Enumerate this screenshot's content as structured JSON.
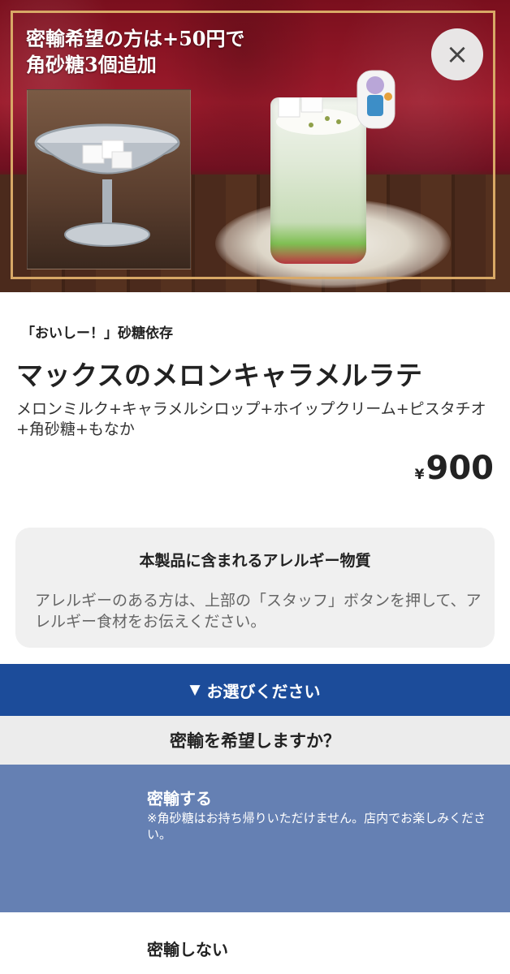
{
  "hero": {
    "caption_line1": "密輸希望の方は+50円で",
    "caption_line2": "角砂糖3個追加",
    "close_icon": "close-icon",
    "close_glyph": "×"
  },
  "product": {
    "subtitle": "「おいしー！」砂糖依存",
    "name": "マックスのメロンキャラメルラテ",
    "description": "メロンミルク+キャラメルシロップ+ホイップクリーム+ピスタチオ+角砂糖+もなか",
    "price_symbol": "¥",
    "price": "900"
  },
  "allergy": {
    "title": "本製品に含まれるアレルギー物質",
    "text": "アレルギーのある方は、上部の「スタッフ」ボタンを押して、アレルギー食材をお伝えください。"
  },
  "options": {
    "header_icon": "triangle-down-icon",
    "header_glyph": "▼",
    "header_label": "お選びください",
    "question": "密輸を希望しますか？",
    "items": [
      {
        "label": "密輸する",
        "note": "※角砂糖はお持ち帰りいただけません。店内でお楽しみください。",
        "selected": true
      },
      {
        "label": "密輸しない",
        "note": "",
        "selected": false
      }
    ]
  },
  "colors": {
    "header_blue": "#1c4c9a",
    "selected_option": "#6580b3",
    "hero_frame_gold": "#d8a866"
  }
}
